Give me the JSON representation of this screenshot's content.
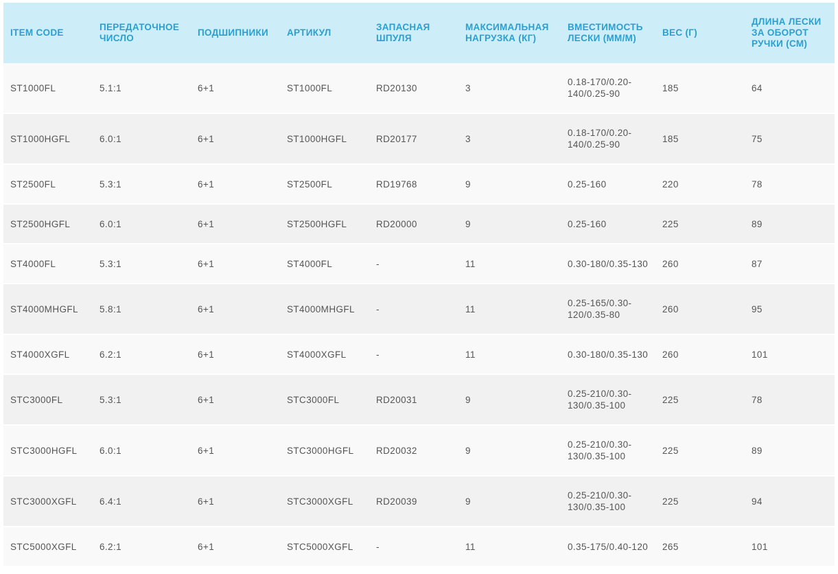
{
  "headers": [
    "ITEM CODE",
    "ПЕРЕДАТОЧНОЕ ЧИСЛО",
    "ПОДШИПНИКИ",
    "АРТИКУЛ",
    "ЗАПАСНАЯ ШПУЛЯ",
    "МАКСИМАЛЬНАЯ НАГРУЗКА (КГ)",
    "ВМЕСТИМОСТЬ ЛЕСКИ (ММ/М)",
    "ВЕС (Г)",
    "ДЛИНА ЛЕСКИ ЗА ОБОРОТ РУЧКИ (СМ)"
  ],
  "rows": [
    [
      "ST1000FL",
      "5.1:1",
      "6+1",
      "ST1000FL",
      "RD20130",
      "3",
      "0.18-170/0.20-140/0.25-90",
      "185",
      "64"
    ],
    [
      "ST1000HGFL",
      "6.0:1",
      "6+1",
      "ST1000HGFL",
      "RD20177",
      "3",
      "0.18-170/0.20-140/0.25-90",
      "185",
      "75"
    ],
    [
      "ST2500FL",
      "5.3:1",
      "6+1",
      "ST2500FL",
      "RD19768",
      "9",
      "0.25-160",
      "220",
      "78"
    ],
    [
      "ST2500HGFL",
      "6.0:1",
      "6+1",
      "ST2500HGFL",
      "RD20000",
      "9",
      "0.25-160",
      "225",
      "89"
    ],
    [
      "ST4000FL",
      "5.3:1",
      "6+1",
      "ST4000FL",
      "-",
      "11",
      "0.30-180/0.35-130",
      "260",
      "87"
    ],
    [
      "ST4000MHGFL",
      "5.8:1",
      "6+1",
      "ST4000MHGFL",
      "-",
      "11",
      "0.25-165/0.30-120/0.35-80",
      "260",
      "95"
    ],
    [
      "ST4000XGFL",
      "6.2:1",
      "6+1",
      "ST4000XGFL",
      "-",
      "11",
      "0.30-180/0.35-130",
      "260",
      "101"
    ],
    [
      "STC3000FL",
      "5.3:1",
      "6+1",
      "STC3000FL",
      "RD20031",
      "9",
      "0.25-210/0.30-130/0.35-100",
      "225",
      "78"
    ],
    [
      "STC3000HGFL",
      "6.0:1",
      "6+1",
      "STC3000HGFL",
      "RD20032",
      "9",
      "0.25-210/0.30-130/0.35-100",
      "225",
      "89"
    ],
    [
      "STC3000XGFL",
      "6.4:1",
      "6+1",
      "STC3000XGFL",
      "RD20039",
      "9",
      "0.25-210/0.30-130/0.35-100",
      "225",
      "94"
    ],
    [
      "STC5000XGFL",
      "6.2:1",
      "6+1",
      "STC5000XGFL",
      "-",
      "11",
      "0.35-175/0.40-120",
      "265",
      "101"
    ]
  ]
}
